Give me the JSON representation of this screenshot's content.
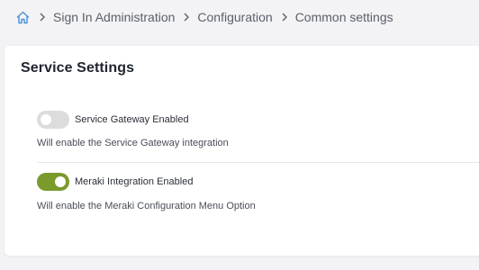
{
  "breadcrumb": {
    "home_icon": "home-icon",
    "items": [
      "Sign In Administration",
      "Configuration",
      "Common settings"
    ],
    "accent_color": "#4a90d9"
  },
  "card": {
    "title": "Service Settings",
    "settings": [
      {
        "label": "Service Gateway Enabled",
        "description": "Will enable the Service Gateway integration",
        "enabled": false
      },
      {
        "label": "Meraki Integration Enabled",
        "description": "Will enable the Meraki Configuration Menu Option",
        "enabled": true
      }
    ],
    "toggle_on_color": "#7a9a2c",
    "toggle_off_color": "#dcdcdc"
  }
}
